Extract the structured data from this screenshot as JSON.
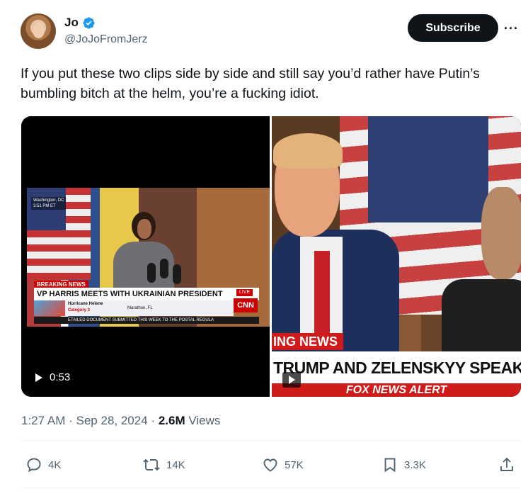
{
  "author": {
    "display_name": "Jo",
    "handle": "@JoJoFromJerz",
    "verified": true,
    "verified_color": "#1d9bf0"
  },
  "header": {
    "subscribe_label": "Subscribe",
    "more_label": "···"
  },
  "tweet": {
    "text": "If you put these two clips side by side and still say you’d rather have Putin’s bumbling bitch at the helm, you’re a fucking idiot."
  },
  "media": {
    "left_clip": {
      "location_line1": "Washington, DC",
      "location_line2": "3:51 PM ET",
      "breaking_label": "BREAKING NEWS",
      "headline": "VP HARRIS MEETS WITH UKRAINIAN PRESIDENT ZELENSKY",
      "live_label": "LIVE",
      "network_logo": "CNN",
      "ticker_title": "Hurricane Helene",
      "ticker_category": "Category 3",
      "ticker_place": "Marathon, FL",
      "crawl": "ETAILED DOCUMENT SUBMITTED THIS WEEK TO THE POSTAL REGULA",
      "duration": "0:53"
    },
    "right_clip": {
      "banner_tag": "ING NEWS",
      "headline": "TRUMP AND ZELENSKYY SPEAK AI",
      "alert": "FOX NEWS ALERT"
    }
  },
  "meta": {
    "time": "1:27 AM",
    "sep": "·",
    "date": "Sep 28, 2024",
    "views_count": "2.6M",
    "views_label": "Views"
  },
  "actions": {
    "replies": "4K",
    "reposts": "14K",
    "likes": "57K",
    "bookmarks": "3.3K"
  },
  "icons": {
    "reply": "reply-icon",
    "repost": "repost-icon",
    "like": "heart-icon",
    "bookmark": "bookmark-icon",
    "share": "share-icon"
  }
}
